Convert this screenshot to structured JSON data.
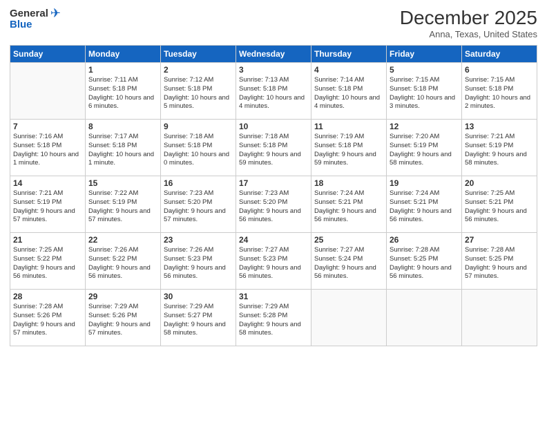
{
  "header": {
    "logo_general": "General",
    "logo_blue": "Blue",
    "month": "December 2025",
    "location": "Anna, Texas, United States"
  },
  "weekdays": [
    "Sunday",
    "Monday",
    "Tuesday",
    "Wednesday",
    "Thursday",
    "Friday",
    "Saturday"
  ],
  "weeks": [
    [
      {
        "day": "",
        "sunrise": "",
        "sunset": "",
        "daylight": ""
      },
      {
        "day": "1",
        "sunrise": "Sunrise: 7:11 AM",
        "sunset": "Sunset: 5:18 PM",
        "daylight": "Daylight: 10 hours and 6 minutes."
      },
      {
        "day": "2",
        "sunrise": "Sunrise: 7:12 AM",
        "sunset": "Sunset: 5:18 PM",
        "daylight": "Daylight: 10 hours and 5 minutes."
      },
      {
        "day": "3",
        "sunrise": "Sunrise: 7:13 AM",
        "sunset": "Sunset: 5:18 PM",
        "daylight": "Daylight: 10 hours and 4 minutes."
      },
      {
        "day": "4",
        "sunrise": "Sunrise: 7:14 AM",
        "sunset": "Sunset: 5:18 PM",
        "daylight": "Daylight: 10 hours and 4 minutes."
      },
      {
        "day": "5",
        "sunrise": "Sunrise: 7:15 AM",
        "sunset": "Sunset: 5:18 PM",
        "daylight": "Daylight: 10 hours and 3 minutes."
      },
      {
        "day": "6",
        "sunrise": "Sunrise: 7:15 AM",
        "sunset": "Sunset: 5:18 PM",
        "daylight": "Daylight: 10 hours and 2 minutes."
      }
    ],
    [
      {
        "day": "7",
        "sunrise": "Sunrise: 7:16 AM",
        "sunset": "Sunset: 5:18 PM",
        "daylight": "Daylight: 10 hours and 1 minute."
      },
      {
        "day": "8",
        "sunrise": "Sunrise: 7:17 AM",
        "sunset": "Sunset: 5:18 PM",
        "daylight": "Daylight: 10 hours and 1 minute."
      },
      {
        "day": "9",
        "sunrise": "Sunrise: 7:18 AM",
        "sunset": "Sunset: 5:18 PM",
        "daylight": "Daylight: 10 hours and 0 minutes."
      },
      {
        "day": "10",
        "sunrise": "Sunrise: 7:18 AM",
        "sunset": "Sunset: 5:18 PM",
        "daylight": "Daylight: 9 hours and 59 minutes."
      },
      {
        "day": "11",
        "sunrise": "Sunrise: 7:19 AM",
        "sunset": "Sunset: 5:18 PM",
        "daylight": "Daylight: 9 hours and 59 minutes."
      },
      {
        "day": "12",
        "sunrise": "Sunrise: 7:20 AM",
        "sunset": "Sunset: 5:19 PM",
        "daylight": "Daylight: 9 hours and 58 minutes."
      },
      {
        "day": "13",
        "sunrise": "Sunrise: 7:21 AM",
        "sunset": "Sunset: 5:19 PM",
        "daylight": "Daylight: 9 hours and 58 minutes."
      }
    ],
    [
      {
        "day": "14",
        "sunrise": "Sunrise: 7:21 AM",
        "sunset": "Sunset: 5:19 PM",
        "daylight": "Daylight: 9 hours and 57 minutes."
      },
      {
        "day": "15",
        "sunrise": "Sunrise: 7:22 AM",
        "sunset": "Sunset: 5:19 PM",
        "daylight": "Daylight: 9 hours and 57 minutes."
      },
      {
        "day": "16",
        "sunrise": "Sunrise: 7:23 AM",
        "sunset": "Sunset: 5:20 PM",
        "daylight": "Daylight: 9 hours and 57 minutes."
      },
      {
        "day": "17",
        "sunrise": "Sunrise: 7:23 AM",
        "sunset": "Sunset: 5:20 PM",
        "daylight": "Daylight: 9 hours and 56 minutes."
      },
      {
        "day": "18",
        "sunrise": "Sunrise: 7:24 AM",
        "sunset": "Sunset: 5:21 PM",
        "daylight": "Daylight: 9 hours and 56 minutes."
      },
      {
        "day": "19",
        "sunrise": "Sunrise: 7:24 AM",
        "sunset": "Sunset: 5:21 PM",
        "daylight": "Daylight: 9 hours and 56 minutes."
      },
      {
        "day": "20",
        "sunrise": "Sunrise: 7:25 AM",
        "sunset": "Sunset: 5:21 PM",
        "daylight": "Daylight: 9 hours and 56 minutes."
      }
    ],
    [
      {
        "day": "21",
        "sunrise": "Sunrise: 7:25 AM",
        "sunset": "Sunset: 5:22 PM",
        "daylight": "Daylight: 9 hours and 56 minutes."
      },
      {
        "day": "22",
        "sunrise": "Sunrise: 7:26 AM",
        "sunset": "Sunset: 5:22 PM",
        "daylight": "Daylight: 9 hours and 56 minutes."
      },
      {
        "day": "23",
        "sunrise": "Sunrise: 7:26 AM",
        "sunset": "Sunset: 5:23 PM",
        "daylight": "Daylight: 9 hours and 56 minutes."
      },
      {
        "day": "24",
        "sunrise": "Sunrise: 7:27 AM",
        "sunset": "Sunset: 5:23 PM",
        "daylight": "Daylight: 9 hours and 56 minutes."
      },
      {
        "day": "25",
        "sunrise": "Sunrise: 7:27 AM",
        "sunset": "Sunset: 5:24 PM",
        "daylight": "Daylight: 9 hours and 56 minutes."
      },
      {
        "day": "26",
        "sunrise": "Sunrise: 7:28 AM",
        "sunset": "Sunset: 5:25 PM",
        "daylight": "Daylight: 9 hours and 56 minutes."
      },
      {
        "day": "27",
        "sunrise": "Sunrise: 7:28 AM",
        "sunset": "Sunset: 5:25 PM",
        "daylight": "Daylight: 9 hours and 57 minutes."
      }
    ],
    [
      {
        "day": "28",
        "sunrise": "Sunrise: 7:28 AM",
        "sunset": "Sunset: 5:26 PM",
        "daylight": "Daylight: 9 hours and 57 minutes."
      },
      {
        "day": "29",
        "sunrise": "Sunrise: 7:29 AM",
        "sunset": "Sunset: 5:26 PM",
        "daylight": "Daylight: 9 hours and 57 minutes."
      },
      {
        "day": "30",
        "sunrise": "Sunrise: 7:29 AM",
        "sunset": "Sunset: 5:27 PM",
        "daylight": "Daylight: 9 hours and 58 minutes."
      },
      {
        "day": "31",
        "sunrise": "Sunrise: 7:29 AM",
        "sunset": "Sunset: 5:28 PM",
        "daylight": "Daylight: 9 hours and 58 minutes."
      },
      {
        "day": "",
        "sunrise": "",
        "sunset": "",
        "daylight": ""
      },
      {
        "day": "",
        "sunrise": "",
        "sunset": "",
        "daylight": ""
      },
      {
        "day": "",
        "sunrise": "",
        "sunset": "",
        "daylight": ""
      }
    ]
  ]
}
